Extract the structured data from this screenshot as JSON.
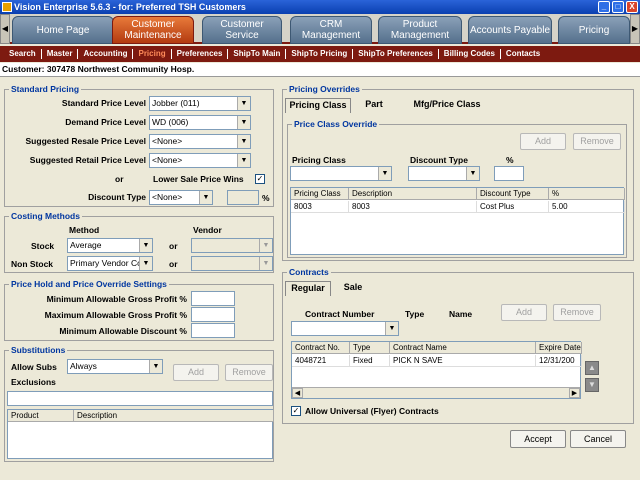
{
  "window": {
    "title": "Vision Enterprise 5.6.3 - for: Preferred TSH Customers",
    "minimize": "_",
    "maximize": "□",
    "close": "X"
  },
  "main_tabs": [
    {
      "label": "Home Page"
    },
    {
      "label": "Customer Maintenance"
    },
    {
      "label": "Customer Service"
    },
    {
      "label": "CRM Management"
    },
    {
      "label": "Product Management"
    },
    {
      "label": "Accounts Payable"
    },
    {
      "label": "Pricing"
    }
  ],
  "sub_nav": [
    "Search",
    "Master",
    "Accounting",
    "Pricing",
    "Preferences",
    "ShipTo Main",
    "ShipTo Pricing",
    "ShipTo Preferences",
    "Billing Codes",
    "Contacts"
  ],
  "customer_bar": "Customer: 307478 Northwest Community Hosp.",
  "standard_pricing": {
    "title": "Standard Pricing",
    "rows": [
      {
        "label": "Standard Price Level",
        "value": "Jobber (011)"
      },
      {
        "label": "Demand Price Level",
        "value": "WD (006)"
      },
      {
        "label": "Suggested Resale Price Level",
        "value": "<None>"
      },
      {
        "label": "Suggested Retail Price Level",
        "value": "<None>"
      }
    ],
    "or": "or",
    "lower_sale_label": "Lower Sale Price Wins",
    "lower_sale_checked": "✓",
    "discount_type_label": "Discount Type",
    "discount_type_value": "<None>",
    "percent": "%"
  },
  "costing": {
    "title": "Costing Methods",
    "method_header": "Method",
    "vendor_header": "Vendor",
    "stock_label": "Stock",
    "stock_value": "Average",
    "nonstock_label": "Non Stock",
    "nonstock_value": "Primary Vendor Co",
    "or": "or"
  },
  "price_hold": {
    "title": "Price Hold and Price Override Settings",
    "rows": [
      {
        "label": "Minimum Allowable Gross Profit %"
      },
      {
        "label": "Maximum Allowable Gross Profit %"
      },
      {
        "label": "Minimum Allowable Discount %"
      }
    ]
  },
  "substitutions": {
    "title": "Substitutions",
    "allow_label": "Allow Subs",
    "allow_value": "Always",
    "add": "Add",
    "remove": "Remove",
    "exclusions_label": "Exclusions",
    "columns": [
      "Product",
      "Description"
    ]
  },
  "pricing_overrides": {
    "title": "Pricing Overrides",
    "tabs": [
      "Pricing Class",
      "Part",
      "Mfg/Price Class"
    ],
    "inner_title": "Price Class Override",
    "add": "Add",
    "remove": "Remove",
    "pricing_class_label": "Pricing Class",
    "discount_type_label": "Discount Type",
    "percent_label": "%",
    "columns": [
      "Pricing Class",
      "Description",
      "Discount Type",
      "%"
    ],
    "rows": [
      [
        "8003",
        "8003",
        "Cost Plus",
        "5.00"
      ]
    ]
  },
  "contracts": {
    "title": "Contracts",
    "tabs": [
      "Regular",
      "Sale"
    ],
    "contract_number_label": "Contract Number",
    "type_label": "Type",
    "name_label": "Name",
    "add": "Add",
    "remove": "Remove",
    "columns": [
      "Contract No.",
      "Type",
      "Contract Name",
      "Expire Date"
    ],
    "rows": [
      [
        "4048721",
        "Fixed",
        "PICK N SAVE",
        "12/31/200"
      ]
    ],
    "allow_universal_label": "Allow Universal (Flyer) Contracts",
    "allow_universal_checked": "✓"
  },
  "actions": {
    "accept": "Accept",
    "cancel": "Cancel"
  }
}
